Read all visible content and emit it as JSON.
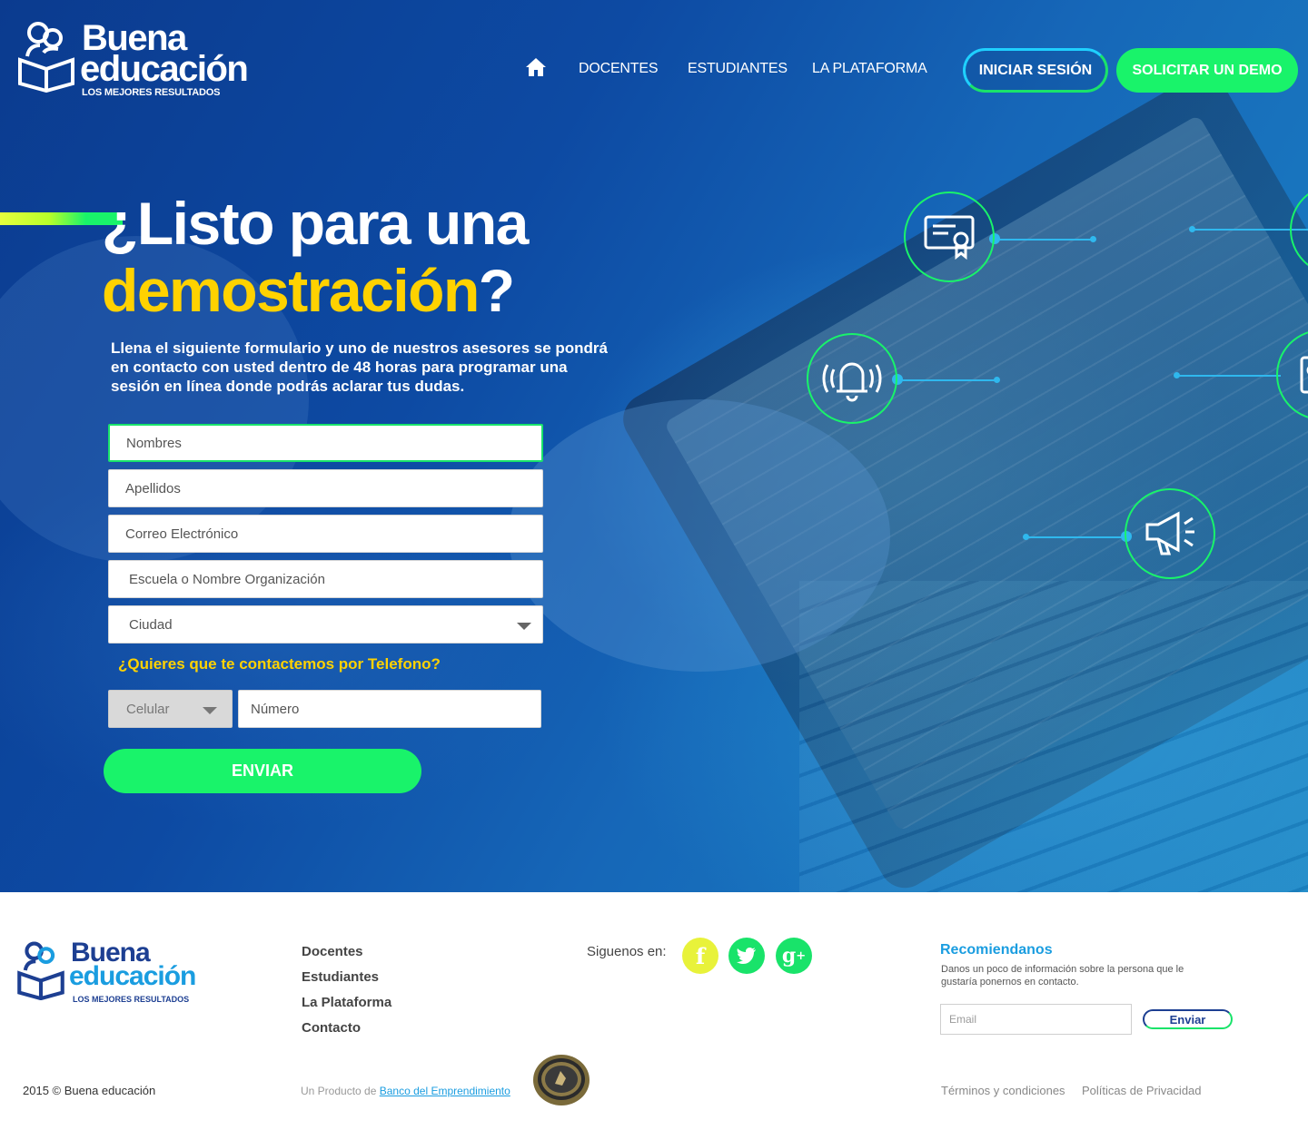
{
  "brand": {
    "name_line1": "Buena",
    "name_line2": "educación",
    "tagline": "LOS MEJORES RESULTADOS"
  },
  "nav": {
    "home_icon": "home-icon",
    "links": [
      "DOCENTES",
      "ESTUDIANTES",
      "LA PLATAFORMA"
    ],
    "login_label": "INICIAR SESIÓN",
    "demo_label": "SOLICITAR UN DEMO"
  },
  "hero": {
    "title_line1": "¿Listo para una",
    "title_line2_highlight": "demostración",
    "title_line2_end": "?",
    "description": "Llena el siguiente formulario y uno de nuestros asesores se pondrá en contacto con usted dentro de 48 horas para programar una sesión en línea donde podrás aclarar tus dudas."
  },
  "form": {
    "fields": [
      {
        "placeholder": "Nombres"
      },
      {
        "placeholder": "Apellidos"
      },
      {
        "placeholder": "Correo Electrónico"
      },
      {
        "placeholder": "Escuela o Nombre Organización"
      }
    ],
    "city_select": "Ciudad",
    "phone_question": "¿Quieres que te contactemos por Telefono?",
    "phone_type": "Celular",
    "phone_number_placeholder": "Número",
    "submit_label": "ENVIAR"
  },
  "feature_icons": [
    "certificate-icon",
    "bell-icon",
    "megaphone-icon",
    "id-card-icon"
  ],
  "footer": {
    "links": [
      "Docentes",
      "Estudiantes",
      "La Plataforma",
      "Contacto"
    ],
    "follow_label": "Siguenos en:",
    "social": [
      {
        "icon": "facebook-icon",
        "glyph": "f",
        "color": "#e8f23a"
      },
      {
        "icon": "twitter-icon",
        "glyph": "t",
        "color": "#19e36a"
      },
      {
        "icon": "google-plus-icon",
        "glyph": "g+",
        "color": "#19e36a"
      }
    ],
    "recommend_title": "Recomiendanos",
    "recommend_desc": "Danos un poco de información sobre la persona que le gustaría ponernos en contacto.",
    "email_placeholder": "Email",
    "send_label": "Enviar",
    "copyright": "2015 © Buena educación",
    "product_prefix": "Un Producto de",
    "product_link": "Banco del Emprendimiento",
    "terms": "Términos y condiciones",
    "privacy": "Políticas de Privacidad"
  },
  "colors": {
    "accent_green": "#19f36a",
    "accent_yellow": "#ffd200",
    "brand_blue": "#1d3f92",
    "link_blue": "#1a9de0"
  }
}
